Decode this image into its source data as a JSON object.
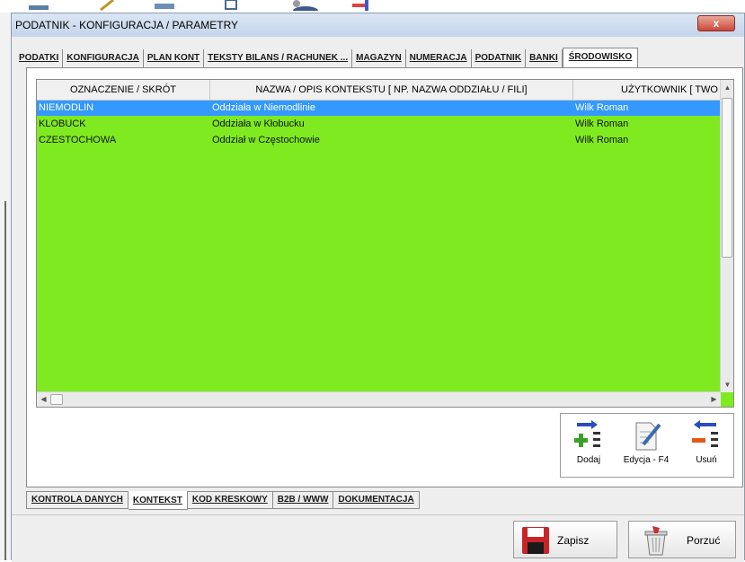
{
  "window": {
    "title": "PODATNIK  - KONFIGURACJA / PARAMETRY",
    "close_label": "x"
  },
  "tabs_top": [
    {
      "label": "PODATKI"
    },
    {
      "label": "KONFIGURACJA"
    },
    {
      "label": "PLAN KONT"
    },
    {
      "label": "TEKSTY BILANS / RACHUNEK ..."
    },
    {
      "label": "MAGAZYN"
    },
    {
      "label": "NUMERACJA"
    },
    {
      "label": "PODATNIK"
    },
    {
      "label": "BANKI"
    },
    {
      "label": "ŚRODOWISKO",
      "active": true
    }
  ],
  "grid": {
    "columns": [
      "OZNACZENIE / SKRÓT",
      "NAZWA / OPIS KONTEKSTU [ NP. NAZWA ODDZIAŁU / FILI]",
      "UŻYTKOWNIK [ TWO"
    ],
    "rows": [
      {
        "code": "NIEMODLIN",
        "name": "Oddziała w Niemodlinie",
        "user": "Wilk Roman",
        "selected": true
      },
      {
        "code": "KLOBUCK",
        "name": "Oddziała w Kłobucku",
        "user": "Wilk Roman",
        "selected": false
      },
      {
        "code": "CZESTOCHOWA",
        "name": "Oddział w Częstochowie",
        "user": "Wilk Roman",
        "selected": false
      }
    ],
    "row_color": "#7fea1f",
    "selected_color": "#3399ff"
  },
  "actions": {
    "add_label": "Dodaj",
    "edit_label": "Edycja - F4",
    "delete_label": "Usuń"
  },
  "tabs_bottom": [
    {
      "label": "KONTROLA DANYCH"
    },
    {
      "label": "KONTEKST",
      "active": true
    },
    {
      "label": "KOD KRESKOWY"
    },
    {
      "label": "B2B / WWW"
    },
    {
      "label": "DOKUMENTACJA"
    }
  ],
  "footer": {
    "save_label": "Zapisz",
    "cancel_label": "Porzuć"
  },
  "icons": {
    "add": "add-list-icon",
    "edit": "edit-document-icon",
    "delete": "remove-list-icon",
    "save": "floppy-disk-icon",
    "cancel": "trash-bin-icon"
  }
}
